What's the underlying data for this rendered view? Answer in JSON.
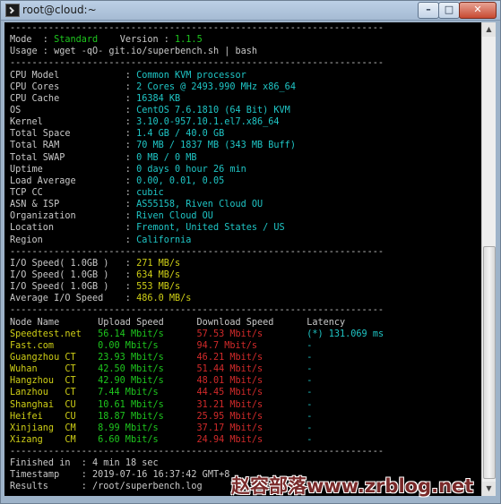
{
  "window": {
    "title": "root@cloud:~",
    "min_label": "0",
    "max_label": "1",
    "close_label": "r"
  },
  "sep": "--------------------------------------------------------------------",
  "header": {
    "mode_label": "Mode  : ",
    "mode_value": "Standard",
    "version_label": "    Version : ",
    "version_value": "1.1.5",
    "usage_label": "Usage : ",
    "usage_value": "wget -qO- git.io/superbench.sh | bash"
  },
  "system": [
    {
      "label": "CPU Model            : ",
      "value": "Common KVM processor"
    },
    {
      "label": "CPU Cores            : ",
      "value": "2 Cores @ 2493.990 MHz x86_64"
    },
    {
      "label": "CPU Cache            : ",
      "value": "16384 KB"
    },
    {
      "label": "OS                   : ",
      "value": "CentOS 7.6.1810 (64 Bit) KVM"
    },
    {
      "label": "Kernel               : ",
      "value": "3.10.0-957.10.1.el7.x86_64"
    },
    {
      "label": "Total Space          : ",
      "value": "1.4 GB / 40.0 GB"
    },
    {
      "label": "Total RAM            : ",
      "value": "70 MB / 1837 MB (343 MB Buff)"
    },
    {
      "label": "Total SWAP           : ",
      "value": "0 MB / 0 MB"
    },
    {
      "label": "Uptime               : ",
      "value": "0 days 0 hour 26 min"
    },
    {
      "label": "Load Average         : ",
      "value": "0.00, 0.01, 0.05"
    },
    {
      "label": "TCP CC               : ",
      "value": "cubic"
    },
    {
      "label": "ASN & ISP            : ",
      "value": "AS55158, Riven Cloud OU"
    },
    {
      "label": "Organization         : ",
      "value": "Riven Cloud OU"
    },
    {
      "label": "Location             : ",
      "value": "Fremont, United States / US"
    },
    {
      "label": "Region               : ",
      "value": "California"
    }
  ],
  "io": [
    {
      "label": "I/O Speed( 1.0GB )   : ",
      "value": "271 MB/s"
    },
    {
      "label": "I/O Speed( 1.0GB )   : ",
      "value": "634 MB/s"
    },
    {
      "label": "I/O Speed( 1.0GB )   : ",
      "value": "553 MB/s"
    },
    {
      "label": "Average I/O Speed    : ",
      "value": "486.0 MB/s"
    }
  ],
  "speed_header": {
    "node": "Node Name       ",
    "upload": "Upload Speed      ",
    "download": "Download Speed      ",
    "latency": "Latency"
  },
  "speed_rows": [
    {
      "node": "Speedtest.net   ",
      "upload": "56.14 Mbit/s      ",
      "download": "57.53 Mbit/s        ",
      "latency": "(*) 131.069 ms"
    },
    {
      "node": "Fast.com        ",
      "upload": "0.00 Mbit/s       ",
      "download": "94.7 Mbit/s         ",
      "latency": "-"
    },
    {
      "node": "Guangzhou CT    ",
      "upload": "23.93 Mbit/s      ",
      "download": "46.21 Mbit/s        ",
      "latency": "-"
    },
    {
      "node": "Wuhan     CT    ",
      "upload": "42.50 Mbit/s      ",
      "download": "51.44 Mbit/s        ",
      "latency": "-"
    },
    {
      "node": "Hangzhou  CT    ",
      "upload": "42.90 Mbit/s      ",
      "download": "48.01 Mbit/s        ",
      "latency": "-"
    },
    {
      "node": "Lanzhou   CT    ",
      "upload": "7.44 Mbit/s       ",
      "download": "44.45 Mbit/s        ",
      "latency": "-"
    },
    {
      "node": "Shanghai  CU    ",
      "upload": "10.61 Mbit/s      ",
      "download": "31.21 Mbit/s        ",
      "latency": "-"
    },
    {
      "node": "Heifei    CU    ",
      "upload": "18.87 Mbit/s      ",
      "download": "25.95 Mbit/s        ",
      "latency": "-"
    },
    {
      "node": "Xinjiang  CM    ",
      "upload": "8.99 Mbit/s       ",
      "download": "37.17 Mbit/s        ",
      "latency": "-"
    },
    {
      "node": "Xizang    CM    ",
      "upload": "6.60 Mbit/s       ",
      "download": "24.94 Mbit/s        ",
      "latency": "-"
    }
  ],
  "footer": [
    {
      "label": "Finished in  : ",
      "value": "4 min 18 sec"
    },
    {
      "label": "Timestamp    : ",
      "value": "2019-07-16 16:37:42 GMT+8"
    },
    {
      "label": "Results      : ",
      "value": "/root/superbench.log"
    }
  ],
  "watermark": "赵容部落www.zrblog.net",
  "scroll": {
    "up": "▲",
    "down": "▼"
  }
}
